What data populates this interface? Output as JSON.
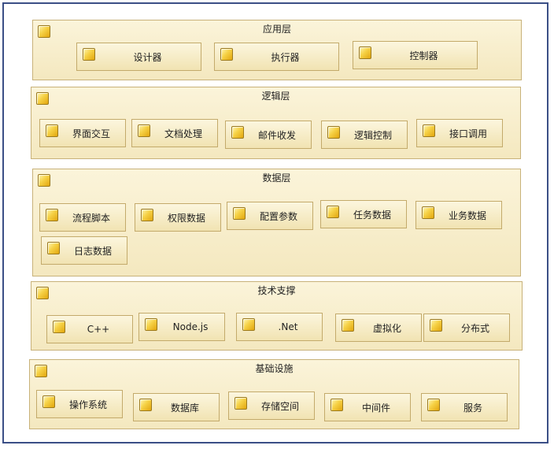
{
  "layers": [
    {
      "title": "应用层",
      "icon": "element-icon",
      "items": [
        "设计器",
        "执行器",
        "控制器"
      ]
    },
    {
      "title": "逻辑层",
      "icon": "element-icon",
      "items": [
        "界面交互",
        "文档处理",
        "邮件收发",
        "逻辑控制",
        "接口调用"
      ]
    },
    {
      "title": "数据层",
      "icon": "element-icon",
      "items": [
        "流程脚本",
        "权限数据",
        "配置参数",
        "任务数据",
        "业务数据",
        "日志数据"
      ]
    },
    {
      "title": "技术支撑",
      "icon": "element-icon",
      "items": [
        "C++",
        "Node.js",
        ".Net",
        "虚拟化",
        "分布式"
      ]
    },
    {
      "title": "基础设施",
      "icon": "element-icon",
      "items": [
        "操作系统",
        "数据库",
        "存储空间",
        "中间件",
        "服务"
      ]
    }
  ]
}
